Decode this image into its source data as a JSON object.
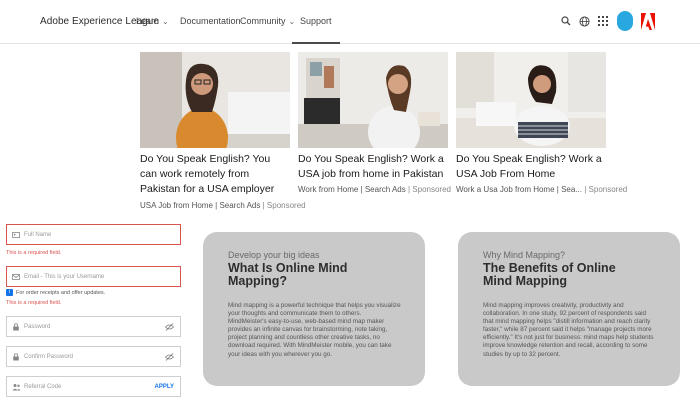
{
  "nav": {
    "brand": "Adobe Experience League",
    "items": [
      {
        "label": "Learn",
        "dropdown": true
      },
      {
        "label": "Documentation",
        "dropdown": false
      },
      {
        "label": "Community",
        "dropdown": true
      },
      {
        "label": "Support",
        "dropdown": false,
        "active": true
      }
    ],
    "icons": [
      "search-icon",
      "globe-icon",
      "apps-grid-icon",
      "avatar",
      "adobe-logo"
    ],
    "brand_color": "#eb1000",
    "avatar_color": "#29a8e0"
  },
  "ads": [
    {
      "title": "Do You Speak English? You can work remotely from Pakistan for a USA employer",
      "source": "USA Job from Home | Search Ads",
      "sponsored": "Sponsored"
    },
    {
      "title": "Do You Speak English? Work a USA job from home in Pakistan",
      "source": "Work from Home | Search Ads",
      "sponsored": "Sponsored"
    },
    {
      "title": "Do You Speak English? Work a USA Job From Home",
      "source": "Work a Usa Job from Home | Sea...",
      "sponsored": "Sponsored"
    }
  ],
  "form": {
    "full_name_placeholder": "Full Name",
    "full_name_error": "This is a required field.",
    "email_placeholder": "Email - This is your Username",
    "email_error": "This is a required field.",
    "consent_text": "For order receipts and offer updates.",
    "password_placeholder": "Password",
    "confirm_password_placeholder": "Confirm Password",
    "referral_placeholder": "Referral Code",
    "apply_label": "APPLY",
    "error_color": "#d9534f",
    "accent_color": "#1473e6"
  },
  "info_cards": [
    {
      "kicker": "Develop your big ideas",
      "heading_lines": [
        "What Is Online Mind",
        "Mapping?"
      ],
      "body": "Mind mapping is a powerful technique that helps you visualize your thoughts and communicate them to others. MindMeister's easy-to-use, web-based mind map maker provides an infinite canvas for brainstorming, note taking, project planning and countless other creative tasks, no download required. With MindMeister mobile, you can take your ideas with you wherever you go."
    },
    {
      "kicker": "Why Mind Mapping?",
      "heading_lines": [
        "The Benefits of Online",
        "Mind Mapping"
      ],
      "body": "Mind mapping improves creativity, productivity and collaboration. In one study, 92 percent of respondents said that mind mapping helps \"distill information and reach clarity faster,\" while 87 percent said it helps \"manage projects more efficiently.\" It's not just for business: mind maps help students improve knowledge retention and recall, according to some studies by up to 32 percent."
    }
  ]
}
